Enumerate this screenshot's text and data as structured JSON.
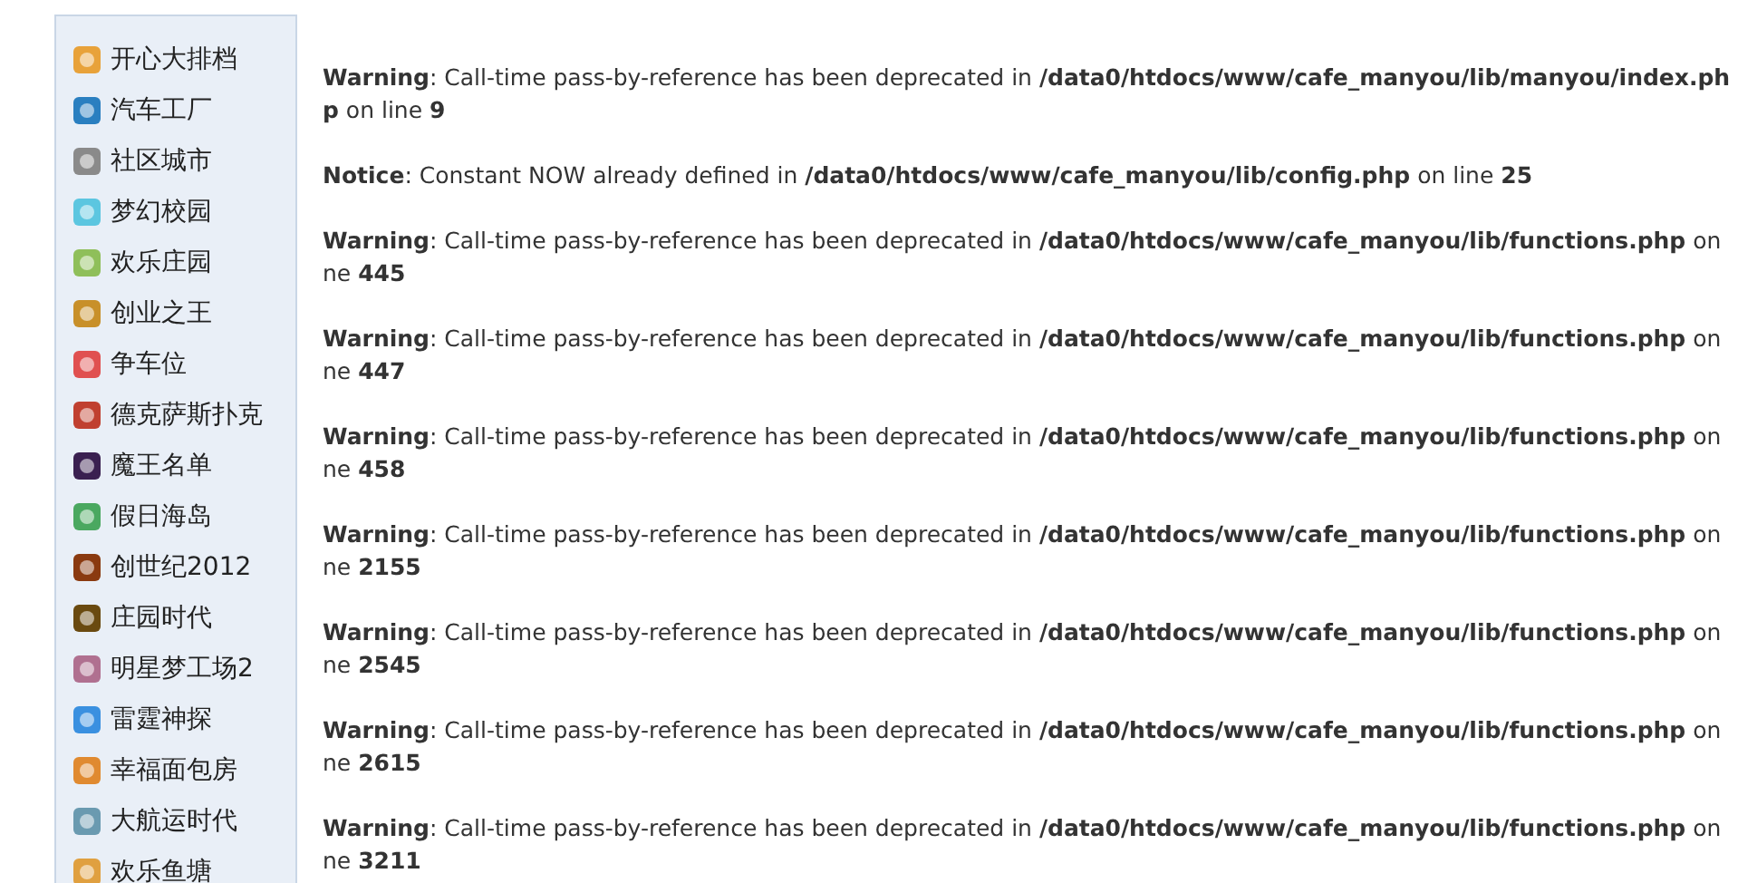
{
  "sidebar": {
    "items": [
      {
        "label": "开心大排档"
      },
      {
        "label": "汽车工厂"
      },
      {
        "label": "社区城市"
      },
      {
        "label": "梦幻校园"
      },
      {
        "label": "欢乐庄园"
      },
      {
        "label": "创业之王"
      },
      {
        "label": "争车位"
      },
      {
        "label": "德克萨斯扑克"
      },
      {
        "label": "魔王名单"
      },
      {
        "label": "假日海岛"
      },
      {
        "label": "创世纪2012"
      },
      {
        "label": "庄园时代"
      },
      {
        "label": "明星梦工场2"
      },
      {
        "label": "雷霆神探"
      },
      {
        "label": "幸福面包房"
      },
      {
        "label": "大航运时代"
      },
      {
        "label": "欢乐鱼塘"
      }
    ]
  },
  "messages": [
    {
      "lines": [
        "**Warning**: Call-time pass-by-reference has been deprecated in **/data0/htdocs/www/cafe_manyou/lib/manyou/index.ph**",
        "**p** on line **9**"
      ]
    },
    {
      "lines": [
        "**Notice**: Constant NOW already defined in **/data0/htdocs/www/cafe_manyou/lib/config.php** on line **25**"
      ]
    },
    {
      "lines": [
        "**Warning**: Call-time pass-by-reference has been deprecated in **/data0/htdocs/www/cafe_manyou/lib/functions.php** on",
        "ne **445**"
      ]
    },
    {
      "lines": [
        "**Warning**: Call-time pass-by-reference has been deprecated in **/data0/htdocs/www/cafe_manyou/lib/functions.php** on",
        "ne **447**"
      ]
    },
    {
      "lines": [
        "**Warning**: Call-time pass-by-reference has been deprecated in **/data0/htdocs/www/cafe_manyou/lib/functions.php** on",
        "ne **458**"
      ]
    },
    {
      "lines": [
        "**Warning**: Call-time pass-by-reference has been deprecated in **/data0/htdocs/www/cafe_manyou/lib/functions.php** on",
        "ne **2155**"
      ]
    },
    {
      "lines": [
        "**Warning**: Call-time pass-by-reference has been deprecated in **/data0/htdocs/www/cafe_manyou/lib/functions.php** on",
        "ne **2545**"
      ]
    },
    {
      "lines": [
        "**Warning**: Call-time pass-by-reference has been deprecated in **/data0/htdocs/www/cafe_manyou/lib/functions.php** on",
        "ne **2615**"
      ]
    },
    {
      "lines": [
        "**Warning**: Call-time pass-by-reference has been deprecated in **/data0/htdocs/www/cafe_manyou/lib/functions.php** on",
        "ne **3211**"
      ]
    }
  ]
}
